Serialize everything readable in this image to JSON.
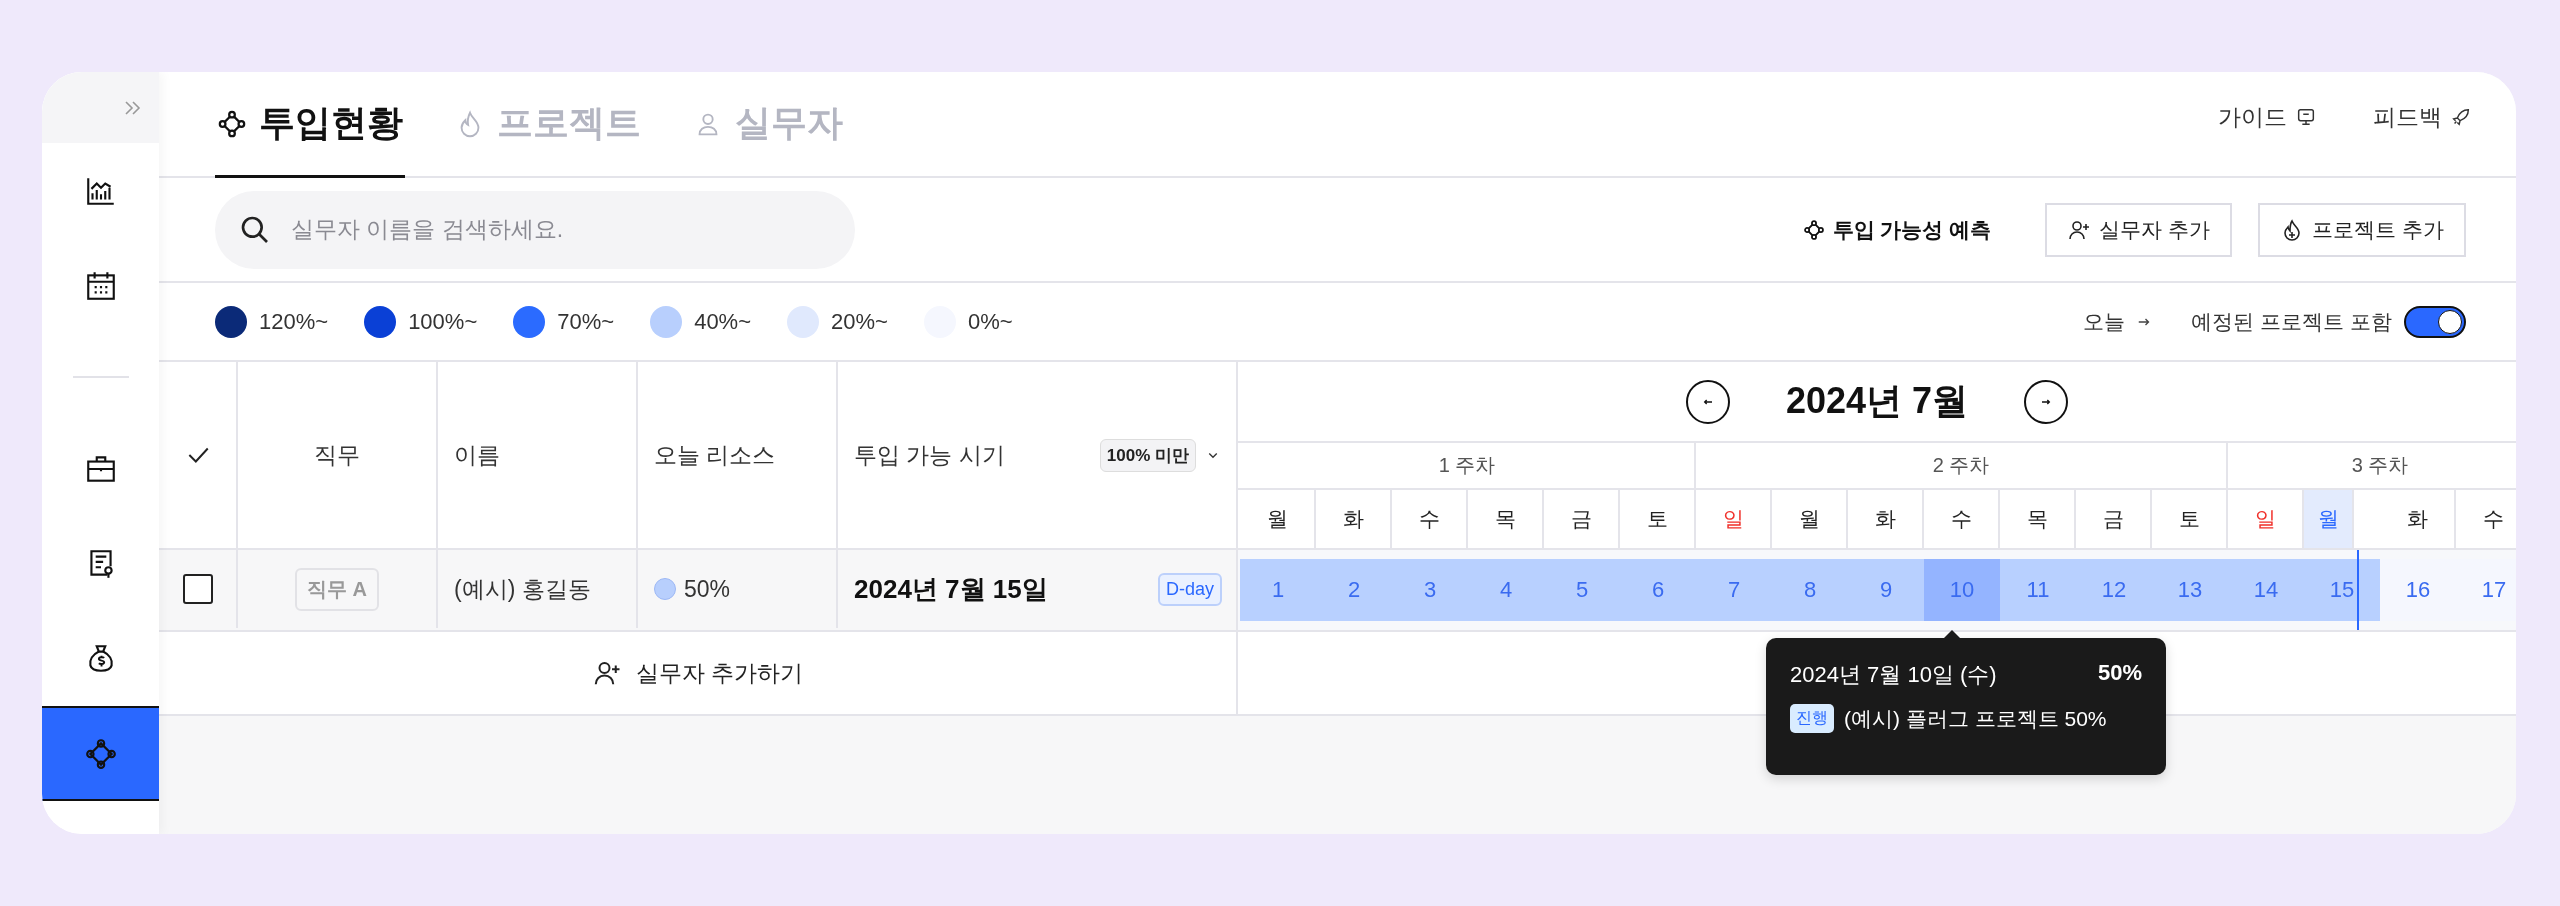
{
  "sidebar": {
    "items": [
      {
        "selected": false
      },
      {
        "selected": false
      },
      {
        "selected": false
      },
      {
        "selected": false
      },
      {
        "selected": false
      },
      {
        "selected": true
      }
    ]
  },
  "tabs": [
    {
      "label": "투입현황",
      "selected": true
    },
    {
      "label": "프로젝트",
      "selected": false
    },
    {
      "label": "실무자",
      "selected": false
    }
  ],
  "header_links": [
    "가이드",
    "피드백"
  ],
  "search": {
    "placeholder": "실무자 이름을 검색하세요."
  },
  "toolbar": {
    "predict": "투입 가능성 예측",
    "buttons": [
      "실무자 추가",
      "프로젝트 추가"
    ]
  },
  "legend": [
    {
      "label": "120%~",
      "color": "#0b2a78"
    },
    {
      "label": "100%~",
      "color": "#0a40d6"
    },
    {
      "label": "70%~",
      "color": "#2b6bff"
    },
    {
      "label": "40%~",
      "color": "#b8cffd"
    },
    {
      "label": "20%~",
      "color": "#e0e9fd"
    },
    {
      "label": "0%~",
      "color": "#f5f7fe"
    }
  ],
  "today_link": "오늘",
  "toggle": {
    "label": "예정된 프로젝트 포함",
    "on": true
  },
  "table": {
    "columns": [
      "직무",
      "이름",
      "오늘 리소스",
      "투입 가능 시기"
    ],
    "filter": "100% 미만",
    "rows": [
      {
        "checked": false,
        "role": "직무 A",
        "name": "(예시) 홍길동",
        "resource": "50%",
        "available": "2024년 7월 15일",
        "badge": "D-day"
      }
    ],
    "add_row": "실무자 추가하기"
  },
  "calendar": {
    "title": "2024년 7월",
    "weeks": [
      {
        "label": "1 주차",
        "days": [
          {
            "weekday": "월",
            "date": "1",
            "holiday": false,
            "today": false,
            "booked": true,
            "selected": false
          },
          {
            "weekday": "화",
            "date": "2",
            "holiday": false,
            "today": false,
            "booked": true,
            "selected": false
          },
          {
            "weekday": "수",
            "date": "3",
            "holiday": false,
            "today": false,
            "booked": true,
            "selected": false
          },
          {
            "weekday": "목",
            "date": "4",
            "holiday": false,
            "today": false,
            "booked": true,
            "selected": false
          },
          {
            "weekday": "금",
            "date": "5",
            "holiday": false,
            "today": false,
            "booked": true,
            "selected": false
          },
          {
            "weekday": "토",
            "date": "6",
            "holiday": false,
            "today": false,
            "booked": true,
            "selected": false
          }
        ]
      },
      {
        "label": "2 주차",
        "days": [
          {
            "weekday": "일",
            "date": "7",
            "holiday": true,
            "today": false,
            "booked": true,
            "selected": false
          },
          {
            "weekday": "월",
            "date": "8",
            "holiday": false,
            "today": false,
            "booked": true,
            "selected": false
          },
          {
            "weekday": "화",
            "date": "9",
            "holiday": false,
            "today": false,
            "booked": true,
            "selected": false
          },
          {
            "weekday": "수",
            "date": "10",
            "holiday": false,
            "today": false,
            "booked": true,
            "selected": true
          },
          {
            "weekday": "목",
            "date": "11",
            "holiday": false,
            "today": false,
            "booked": true,
            "selected": false
          },
          {
            "weekday": "금",
            "date": "12",
            "holiday": false,
            "today": false,
            "booked": true,
            "selected": false
          },
          {
            "weekday": "토",
            "date": "13",
            "holiday": false,
            "today": false,
            "booked": true,
            "selected": false
          }
        ]
      },
      {
        "label": "3 주차",
        "days": [
          {
            "weekday": "일",
            "date": "14",
            "holiday": true,
            "today": false,
            "booked": true,
            "selected": false
          },
          {
            "weekday": "월",
            "date": "15",
            "holiday": false,
            "today": true,
            "booked": true,
            "selected": false
          },
          {
            "weekday": "화",
            "date": "16",
            "holiday": false,
            "today": false,
            "booked": false,
            "selected": false
          },
          {
            "weekday": "수",
            "date": "17",
            "holiday": false,
            "today": false,
            "booked": false,
            "selected": false
          }
        ]
      }
    ]
  },
  "tooltip": {
    "date": "2024년 7월 10일 (수)",
    "total": "50%",
    "items": [
      {
        "status": "진행",
        "text": "(예시) 플러그 프로젝트 50%"
      }
    ]
  }
}
